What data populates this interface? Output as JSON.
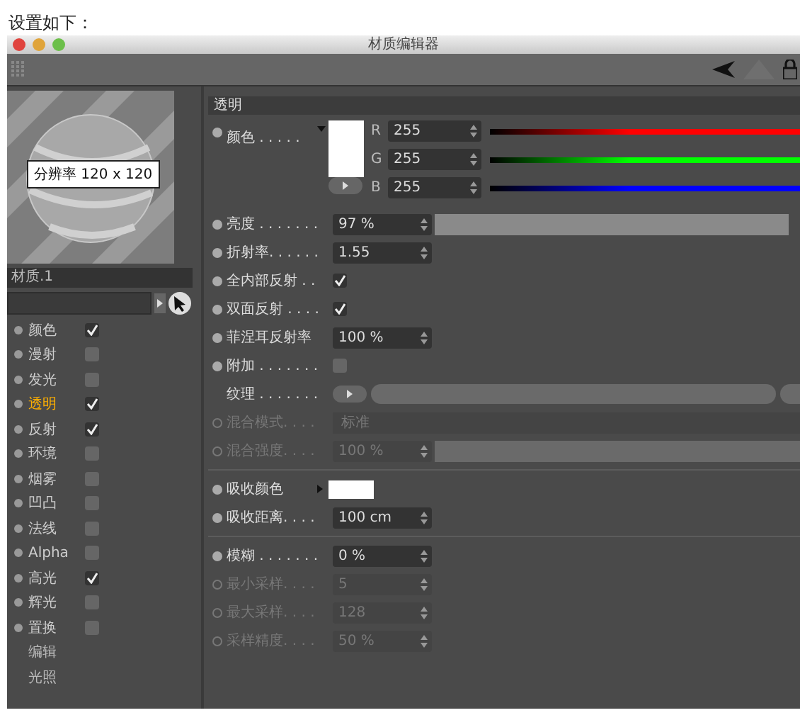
{
  "intro": "设置如下：",
  "window": {
    "title": "材质编辑器"
  },
  "preview": {
    "tooltip": "分辨率 120 x 120"
  },
  "material_name": "材质.1",
  "channels": [
    {
      "kind": "channel",
      "label": "颜色",
      "checked": true,
      "selected": false
    },
    {
      "kind": "channel",
      "label": "漫射",
      "checked": false,
      "selected": false
    },
    {
      "kind": "channel",
      "label": "发光",
      "checked": false,
      "selected": false
    },
    {
      "kind": "channel",
      "label": "透明",
      "checked": true,
      "selected": true
    },
    {
      "kind": "channel",
      "label": "反射",
      "checked": true,
      "selected": false
    },
    {
      "kind": "channel",
      "label": "环境",
      "checked": false,
      "selected": false
    },
    {
      "kind": "channel",
      "label": "烟雾",
      "checked": false,
      "selected": false
    },
    {
      "kind": "channel",
      "label": "凹凸",
      "checked": false,
      "selected": false
    },
    {
      "kind": "channel",
      "label": "法线",
      "checked": false,
      "selected": false
    },
    {
      "kind": "channel",
      "label": "Alpha",
      "checked": false,
      "selected": false
    },
    {
      "kind": "channel",
      "label": "高光",
      "checked": true,
      "selected": false
    },
    {
      "kind": "channel",
      "label": "辉光",
      "checked": false,
      "selected": false
    },
    {
      "kind": "channel",
      "label": "置换",
      "checked": false,
      "selected": false
    },
    {
      "kind": "link",
      "label": "编辑"
    },
    {
      "kind": "link",
      "label": "光照"
    }
  ],
  "section": {
    "title": "透明"
  },
  "rows": [
    {
      "kind": "color",
      "label": "颜色 . . . . .",
      "disabled": false,
      "channels": [
        {
          "letter": "R",
          "value": "255",
          "color": "#ff0000",
          "level": 1
        },
        {
          "letter": "G",
          "value": "255",
          "color": "#00ff00",
          "level": 1
        },
        {
          "letter": "B",
          "value": "255",
          "color": "#0000ff",
          "level": 1
        }
      ]
    },
    {
      "kind": "slider",
      "label": "亮度 . . . . . . .",
      "value": "97 %",
      "level": 0.97,
      "disabled": false
    },
    {
      "kind": "number",
      "label": "折射率. . . . . .",
      "value": "1.55",
      "disabled": false
    },
    {
      "kind": "checkbox",
      "label": "全内部反射 . .",
      "checked": true,
      "disabled": false
    },
    {
      "kind": "checkbox",
      "label": "双面反射 . . . .",
      "checked": true,
      "disabled": false
    },
    {
      "kind": "number",
      "label": "菲涅耳反射率",
      "value": "100 %",
      "disabled": false
    },
    {
      "kind": "checkbox",
      "label": "附加 . . . . . . .",
      "checked": false,
      "disabled": false
    },
    {
      "kind": "texture",
      "label": "纹理 . . . . . . .",
      "disabled": false
    },
    {
      "kind": "dropdown",
      "label": "混合模式. . . .",
      "value": "标准",
      "disabled": true
    },
    {
      "kind": "slider",
      "label": "混合强度. . . .",
      "value": "100 %",
      "level": 1,
      "disabled": true
    },
    {
      "kind": "divider"
    },
    {
      "kind": "swatch",
      "label": "吸收颜色",
      "disabled": false
    },
    {
      "kind": "number",
      "label": "吸收距离. . . .",
      "value": "100 cm",
      "disabled": false
    },
    {
      "kind": "divider"
    },
    {
      "kind": "number",
      "label": "模糊 . . . . . . .",
      "value": "0 %",
      "disabled": false
    },
    {
      "kind": "number",
      "label": "最小采样. . . .",
      "value": "5",
      "disabled": true
    },
    {
      "kind": "number",
      "label": "最大采样. . . .",
      "value": "128",
      "disabled": true
    },
    {
      "kind": "number",
      "label": "采样精度. . . .",
      "value": "50 %",
      "disabled": true
    }
  ]
}
